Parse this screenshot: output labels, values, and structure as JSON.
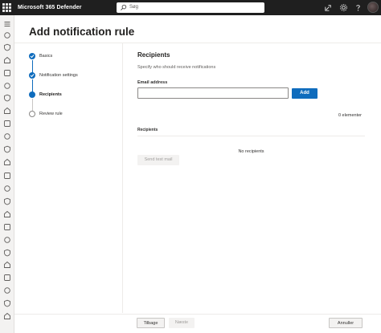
{
  "app": {
    "title": "Microsoft 365 Defender"
  },
  "search": {
    "placeholder": "Søg"
  },
  "topbar": {
    "icons": [
      "app-launcher-icon",
      "share-icon",
      "gear-icon",
      "help-icon"
    ]
  },
  "nav_rail": {
    "icons": [
      "menu-icon",
      "home-icon",
      "shield-icon",
      "incidents-icon",
      "hunting-icon",
      "action-center-icon",
      "trophy-icon",
      "threat-analytics-icon",
      "secure-score-icon",
      "learning-icon",
      "trials-icon",
      "partner-icon",
      "assets-icon",
      "devices-icon",
      "identities-icon",
      "email-icon",
      "cloud-apps-icon",
      "reports-icon",
      "audit-icon",
      "health-icon",
      "permissions-icon",
      "settings-icon",
      "more-icon",
      "customize-icon"
    ]
  },
  "page": {
    "title": "Add notification rule"
  },
  "steps": [
    {
      "label": "Basics",
      "state": "done"
    },
    {
      "label": "Notification settings",
      "state": "done"
    },
    {
      "label": "Recipients",
      "state": "current"
    },
    {
      "label": "Review rule",
      "state": "todo"
    }
  ],
  "recipients": {
    "title": "Recipients",
    "description": "Specify who should receive notifications",
    "email_label": "Email address",
    "email_value": "",
    "add_label": "Add",
    "count_text": "0 elementer",
    "column_header": "Recipients",
    "empty_text": "No recipients",
    "test_mail_label": "Send test mail"
  },
  "footer": {
    "back_label": "Tilbage",
    "next_label": "Næste",
    "cancel_label": "Annuller"
  },
  "colors": {
    "accent": "#0f6cbd",
    "topbar": "#1f1f1f"
  }
}
